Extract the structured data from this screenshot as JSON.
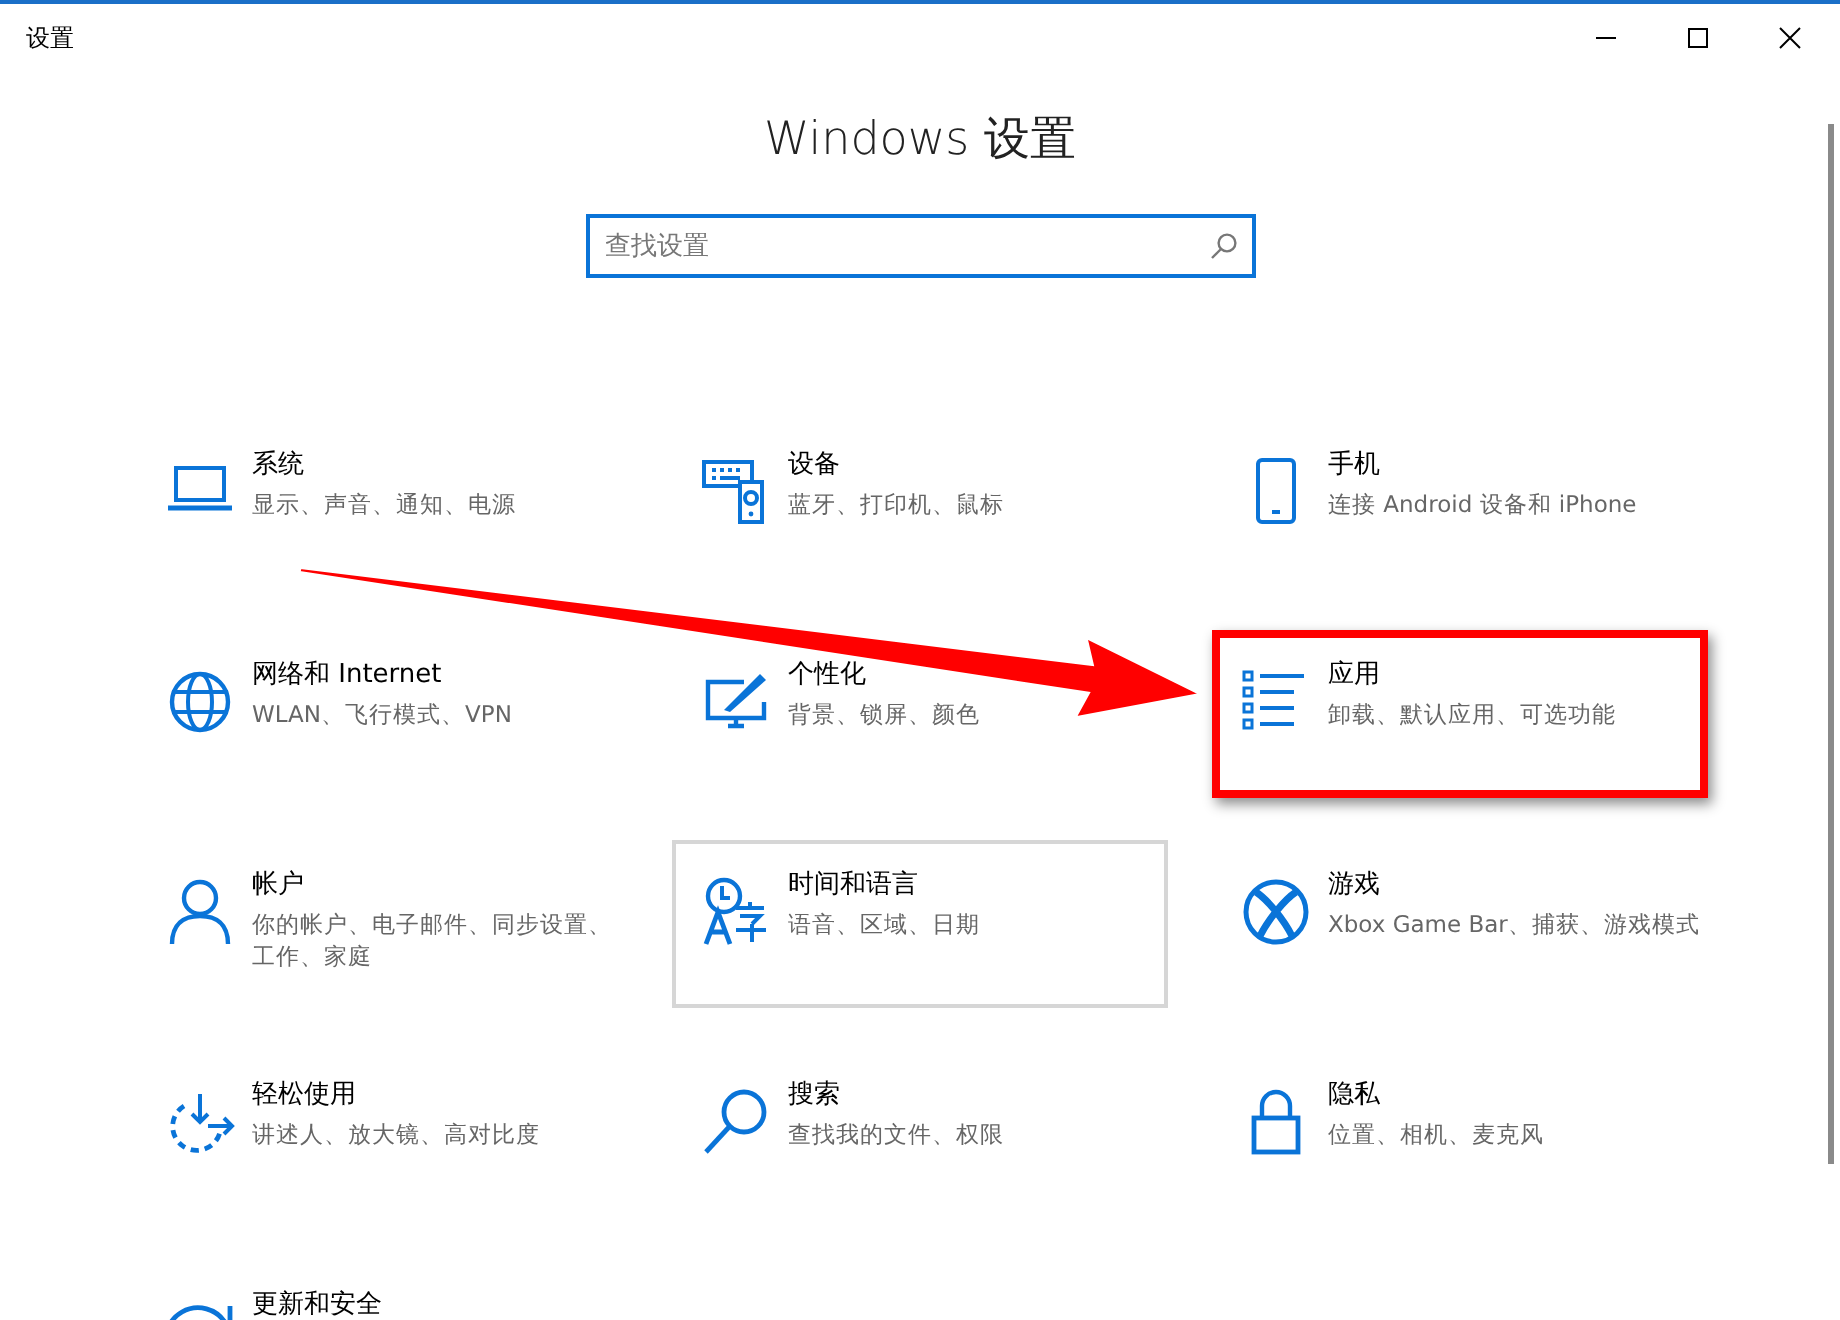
{
  "window": {
    "title": "设置",
    "controls": [
      {
        "kind": "minimize"
      },
      {
        "kind": "maximize"
      },
      {
        "kind": "close"
      }
    ]
  },
  "heading": "Windows 设置",
  "search": {
    "placeholder": "查找设置"
  },
  "items": [
    {
      "kind": "laptop",
      "title": "系统",
      "subtitle": "显示、声音、通知、电源",
      "outlined": false,
      "marked": false
    },
    {
      "kind": "devices",
      "title": "设备",
      "subtitle": "蓝牙、打印机、鼠标",
      "outlined": false,
      "marked": false
    },
    {
      "kind": "phone",
      "title": "手机",
      "subtitle": "连接 Android 设备和 iPhone",
      "outlined": false,
      "marked": false
    },
    {
      "kind": "globe",
      "title": "网络和 Internet",
      "subtitle": "WLAN、飞行模式、VPN",
      "outlined": false,
      "marked": false
    },
    {
      "kind": "paint",
      "title": "个性化",
      "subtitle": "背景、锁屏、颜色",
      "outlined": false,
      "marked": false
    },
    {
      "kind": "list",
      "title": "应用",
      "subtitle": "卸载、默认应用、可选功能",
      "outlined": false,
      "marked": true
    },
    {
      "kind": "person",
      "title": "帐户",
      "subtitle": "你的帐户、电子邮件、同步设置、工作、家庭",
      "outlined": false,
      "marked": false
    },
    {
      "kind": "language",
      "title": "时间和语言",
      "subtitle": "语音、区域、日期",
      "outlined": true,
      "marked": false
    },
    {
      "kind": "xbox",
      "title": "游戏",
      "subtitle": "Xbox Game Bar、捕获、游戏模式",
      "outlined": false,
      "marked": false
    },
    {
      "kind": "ease",
      "title": "轻松使用",
      "subtitle": "讲述人、放大镜、高对比度",
      "outlined": false,
      "marked": false
    },
    {
      "kind": "magnifier",
      "title": "搜索",
      "subtitle": "查找我的文件、权限",
      "outlined": false,
      "marked": false
    },
    {
      "kind": "lock",
      "title": "隐私",
      "subtitle": "位置、相机、麦克风",
      "outlined": false,
      "marked": false
    },
    {
      "kind": "refresh",
      "title": "更新和安全",
      "outlined": false,
      "marked": false
    }
  ]
}
